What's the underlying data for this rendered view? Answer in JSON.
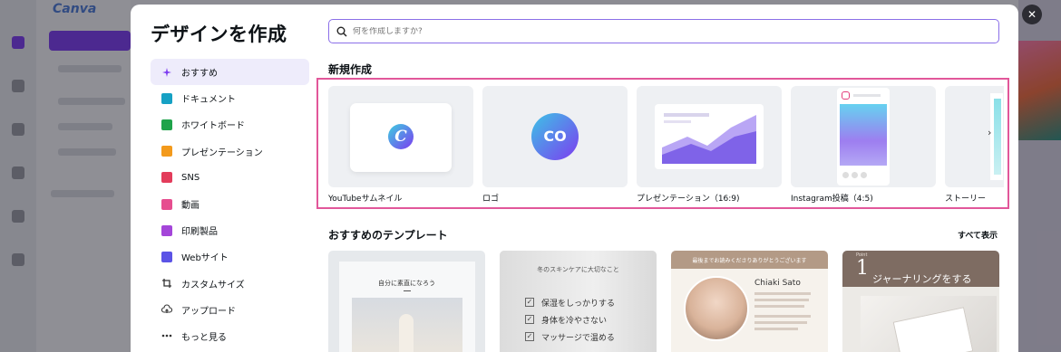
{
  "background": {
    "logo": "Canva"
  },
  "modal": {
    "title": "デザインを作成",
    "close_glyph": "✕",
    "search": {
      "placeholder": "何を作成しますか?"
    },
    "nav": [
      {
        "label": "おすすめ",
        "icon": "sparkle-icon",
        "color": "#7d3cf0"
      },
      {
        "label": "ドキュメント",
        "icon": "document-icon",
        "color": "#16a1c4"
      },
      {
        "label": "ホワイトボード",
        "icon": "whiteboard-icon",
        "color": "#1fa34a"
      },
      {
        "label": "プレゼンテーション",
        "icon": "presentation-icon",
        "color": "#f39a1c"
      },
      {
        "label": "SNS",
        "icon": "heart-icon",
        "color": "#e33c5b"
      },
      {
        "label": "動画",
        "icon": "video-icon",
        "color": "#e64d8f"
      },
      {
        "label": "印刷製品",
        "icon": "printer-icon",
        "color": "#a446d9"
      },
      {
        "label": "Webサイト",
        "icon": "website-icon",
        "color": "#5b53e6"
      },
      {
        "label": "カスタムサイズ",
        "icon": "custom-size-icon",
        "color": "#333333"
      },
      {
        "label": "アップロード",
        "icon": "upload-cloud-icon",
        "color": "#333333"
      },
      {
        "label": "もっと見る",
        "icon": "more-dots-icon",
        "color": "#333333"
      }
    ],
    "new_section_title": "新規作成",
    "new_cards": [
      {
        "label": "YouTubeサムネイル"
      },
      {
        "label": "ロゴ"
      },
      {
        "label": "プレゼンテーション（16:9)"
      },
      {
        "label": "Instagram投稿（4:5)"
      },
      {
        "label": "ストーリー"
      }
    ],
    "next_glyph": "›",
    "recommended_title": "おすすめのテンプレート",
    "see_all": "すべて表示",
    "templates": [
      {
        "text": "自分に素直になろう"
      },
      {
        "text": "冬のスキンケアに大切なこと",
        "items": [
          "保湿をしっかりする",
          "身体を冷やさない",
          "マッサージで温める"
        ]
      },
      {
        "text": "最後までお読みくださりありがとうございます",
        "name": "Chiaki Sato"
      },
      {
        "text": "ジャーナリングをする",
        "number": "1",
        "point": "Point"
      }
    ]
  }
}
